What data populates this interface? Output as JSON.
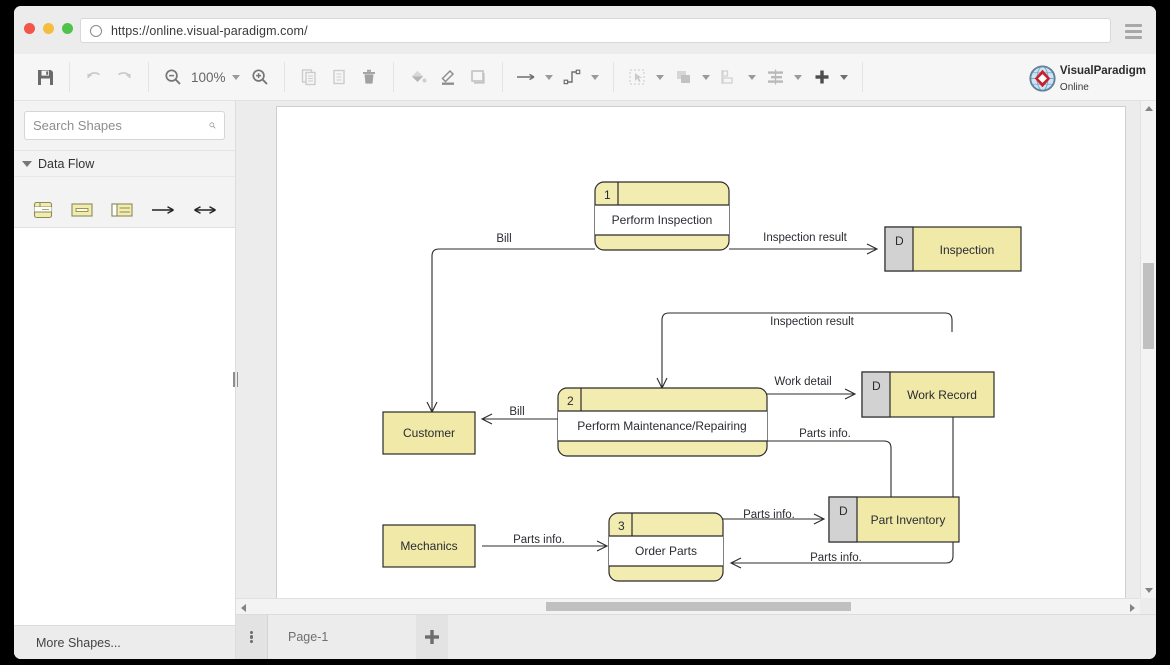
{
  "browser": {
    "url": "https://online.visual-paradigm.com/",
    "reload_icon": "reload-icon",
    "menu_icon": "hamburger-menu-icon"
  },
  "toolbar": {
    "save_label": "Save",
    "undo_label": "Undo",
    "redo_label": "Redo",
    "zoom_out_label": "Zoom Out",
    "zoom_level": "100%",
    "zoom_in_label": "Zoom In",
    "copy_label": "Copy",
    "paste_label": "Paste",
    "delete_label": "Delete",
    "fill_color_label": "Fill Color",
    "line_color_label": "Line Color",
    "shadow_label": "Shape Style",
    "connector_label": "Connector Style",
    "route_label": "Connector Route",
    "select_label": "Selection",
    "arrange_label": "Arrange",
    "distribute_label": "Distribute",
    "align_label": "Align",
    "add_label": "Add"
  },
  "logo": {
    "line1": "VisualParadigm",
    "line2": "Online"
  },
  "sidebar": {
    "search": {
      "value": "",
      "placeholder": "Search Shapes"
    },
    "section": {
      "label": "Data Flow",
      "expanded": true
    },
    "shapes": [
      {
        "name": "process-shape",
        "label": "Process"
      },
      {
        "name": "external-entity-shape",
        "label": "External Entity"
      },
      {
        "name": "data-store-shape",
        "label": "Data Store"
      },
      {
        "name": "data-flow-arrow-shape",
        "label": "Data Flow"
      },
      {
        "name": "bidirectional-data-flow-shape",
        "label": "Bidirectional Data Flow"
      }
    ],
    "more_shapes_label": "More Shapes..."
  },
  "pagebar": {
    "menu_icon": "page-options-icon",
    "tab_label": "Page-1",
    "add_icon": "add-page-icon",
    "add_label": "Add Page"
  },
  "diagram": {
    "title": "Data Flow Diagram",
    "colors": {
      "process_fill": "#f2ecb0",
      "process_body_fill": "#ffffff",
      "entity_fill": "#f0e9a8",
      "store_fill": "#f0e9a8",
      "store_key_fill": "#d2d2d2",
      "stroke": "#2b2b2b",
      "label_color": "#2b2b32"
    },
    "processes": [
      {
        "id": "p1",
        "number": "1",
        "name": "Perform Inspection"
      },
      {
        "id": "p2",
        "number": "2",
        "name": "Perform Maintenance/Repairing"
      },
      {
        "id": "p3",
        "number": "3",
        "name": "Order Parts"
      }
    ],
    "entities": [
      {
        "id": "e1",
        "name": "Customer"
      },
      {
        "id": "e2",
        "name": "Mechanics"
      }
    ],
    "datastores": [
      {
        "id": "d1",
        "key": "D",
        "name": "Inspection"
      },
      {
        "id": "d2",
        "key": "D",
        "name": "Work Record"
      },
      {
        "id": "d3",
        "key": "D",
        "name": "Part Inventory"
      }
    ],
    "flows": [
      {
        "id": "f1",
        "label": "Bill",
        "from": "Perform Inspection",
        "to": "Customer"
      },
      {
        "id": "f2",
        "label": "Inspection result",
        "from": "Perform Inspection",
        "to": "Inspection"
      },
      {
        "id": "f3",
        "label": "Inspection result",
        "from": "Inspection",
        "to": "Perform Maintenance/Repairing"
      },
      {
        "id": "f4",
        "label": "Bill",
        "from": "Perform Maintenance/Repairing",
        "to": "Customer"
      },
      {
        "id": "f5",
        "label": "Work detail",
        "from": "Perform Maintenance/Repairing",
        "to": "Work Record"
      },
      {
        "id": "f6",
        "label": "Parts info.",
        "from": "Perform Maintenance/Repairing",
        "to": "Part Inventory"
      },
      {
        "id": "f7",
        "label": "Parts info.",
        "from": "Mechanics",
        "to": "Order Parts"
      },
      {
        "id": "f8",
        "label": "Parts info.",
        "from": "Order Parts",
        "to": "Part Inventory"
      },
      {
        "id": "f9",
        "label": "Parts info.",
        "from": "Work Record",
        "to": "Order Parts"
      }
    ]
  }
}
